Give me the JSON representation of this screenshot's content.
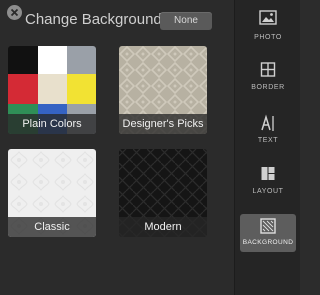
{
  "header": {
    "title": "Change Background",
    "none_label": "None"
  },
  "tiles": [
    {
      "label": "Plain Colors"
    },
    {
      "label": "Designer's Picks"
    },
    {
      "label": "Classic"
    },
    {
      "label": "Modern"
    }
  ],
  "plain_colors": [
    "#111111",
    "#ffffff",
    "#9aa0a8",
    "#d42a35",
    "#e8e0cc",
    "#f2e233",
    "#2f8f57",
    "#3563c4",
    "#9aa0a8"
  ],
  "sidebar": {
    "items": [
      {
        "label": "PHOTO",
        "icon": "photo-icon"
      },
      {
        "label": "BORDER",
        "icon": "border-icon"
      },
      {
        "label": "TEXT",
        "icon": "text-icon"
      },
      {
        "label": "LAYOUT",
        "icon": "layout-icon"
      },
      {
        "label": "BACKGROUND",
        "icon": "background-icon"
      }
    ],
    "active": "BACKGROUND"
  },
  "colors": {
    "panel_bg": "#2b2b2b",
    "sidebar_bg": "#252525",
    "active_bg": "#5d5d5d"
  }
}
